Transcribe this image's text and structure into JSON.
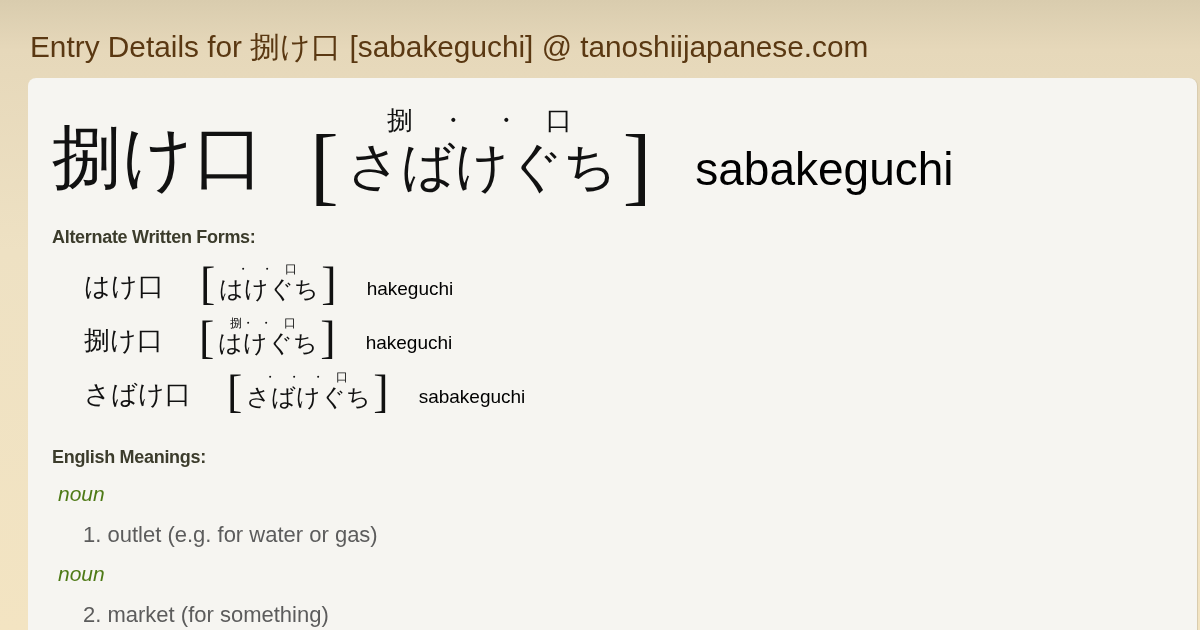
{
  "page": {
    "title": "Entry Details for 捌け口 [sabakeguchi] @ tanoshiijapanese.com"
  },
  "entry": {
    "headword": "捌け口",
    "bracket_left": "[",
    "reading": "さばけぐち",
    "marks": [
      "捌",
      "・",
      "・",
      "口"
    ],
    "bracket_right": "]",
    "romaji": "sabakeguchi"
  },
  "alternate_forms": {
    "heading": "Alternate Written Forms:",
    "items": [
      {
        "headword": "はけ口",
        "bracket_left": "[",
        "reading": "はけぐち",
        "marks": [
          "・",
          "・",
          "口"
        ],
        "bracket_right": "]",
        "romaji": "hakeguchi"
      },
      {
        "headword": "捌け口",
        "bracket_left": "[",
        "reading": "はけぐち",
        "marks": [
          "捌・",
          "・",
          "口"
        ],
        "bracket_right": "]",
        "romaji": "hakeguchi"
      },
      {
        "headword": "さばけ口",
        "bracket_left": "[",
        "reading": "さばけぐち",
        "marks": [
          "・",
          "・",
          "・",
          "口"
        ],
        "bracket_right": "]",
        "romaji": "sabakeguchi"
      }
    ]
  },
  "meanings": {
    "heading": "English Meanings:",
    "senses": [
      {
        "part_of_speech": "noun",
        "definition": "1. outlet (e.g. for water or gas)"
      },
      {
        "part_of_speech": "noun",
        "definition": "2. market (for something)"
      }
    ]
  }
}
